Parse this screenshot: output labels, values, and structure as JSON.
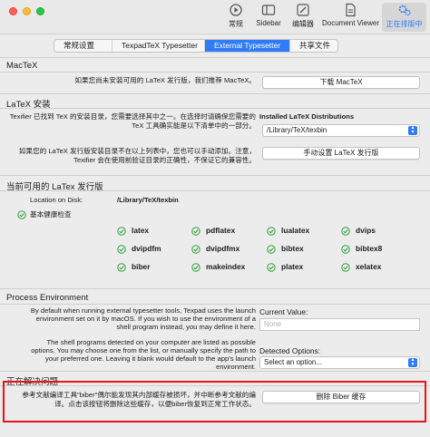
{
  "toolbar": {
    "items": [
      {
        "label": "常规",
        "icon": "general-icon"
      },
      {
        "label": "Sidebar",
        "icon": "sidebar-icon"
      },
      {
        "label": "编辑器",
        "icon": "editor-icon"
      },
      {
        "label": "Document Viewer",
        "icon": "document-viewer-icon"
      },
      {
        "label": "正在排版中",
        "icon": "gears-icon"
      }
    ]
  },
  "tabs": [
    "常规设置",
    "TexpadTeX Typesetter",
    "External Typesetter",
    "共享文件"
  ],
  "mactex": {
    "title": "MacTeX",
    "desc": "如果您尚未安装可用的 LaTeX 发行版，我们推荐 MacTeX。",
    "button": "下载 MacTeX"
  },
  "latex_install": {
    "title": "LaTeX 安装",
    "desc_line1": "Texifier 已找到 TeX 的安装目录，您需要选择其中之一。在选择时请确保您需要的",
    "desc_line2": "TeX 工具确实能是以下清单中的一部分。",
    "installed_label": "Installed LaTeX Distributions",
    "selected_distribution": "/Library/TeX/texbin",
    "manual_desc_line1": "如果您的 LaTeX 发行版安装目录不在以上列表中，您也可以手动添加。注意，",
    "manual_desc_line2": "Texifier 会在使用前验证目录的正确性，不保证它的兼容性。",
    "manual_button": "手动设置 LaTeX 发行版"
  },
  "current": {
    "title": "当前可用的 LaTex 发行版",
    "location_label": "Location on Disk:",
    "location_value": "/Library/TeX/texbin",
    "health_label": "基本健康检查",
    "tools": [
      "latex",
      "pdflatex",
      "lualatex",
      "dvips",
      "dvipdfm",
      "dvipdfmx",
      "bibtex",
      "bibtex8",
      "biber",
      "makeindex",
      "platex",
      "xelatex"
    ]
  },
  "process": {
    "title": "Process Environment",
    "desc1_line1": "By default when running external typesetter tools, Texpad uses the launch",
    "desc1_line2": "environment set on it by macOS. If you wish to use the environment of a",
    "desc1_line3": "shell program instead, you may define it here.",
    "desc2_line1": "The shell programs detected on your computer are listed as possible",
    "desc2_line2": "options. You may choose one from the list, or manually specify the path to",
    "desc2_line3": "your preferred one. Leaving it blank would default to the app's launch",
    "desc2_line4": "environment.",
    "current_value_label": "Current Value:",
    "current_value_placeholder": "None",
    "detected_label": "Detected Options:",
    "detected_select": "Select an option..."
  },
  "resolving": {
    "title": "正在解决问题",
    "desc_line1": "参考文献编译工具\"biber\"偶尔能发现其内部缓存被损坏，并中断参考文献的编",
    "desc_line2": "译。点击该按钮将删除这些缓存，以便biber恢复到正常工作状态。",
    "button": "删除 Biber 缓存"
  },
  "colors": {
    "accent": "#2f7cf6",
    "check": "#2fa33c",
    "highlight": "#e8141b"
  }
}
